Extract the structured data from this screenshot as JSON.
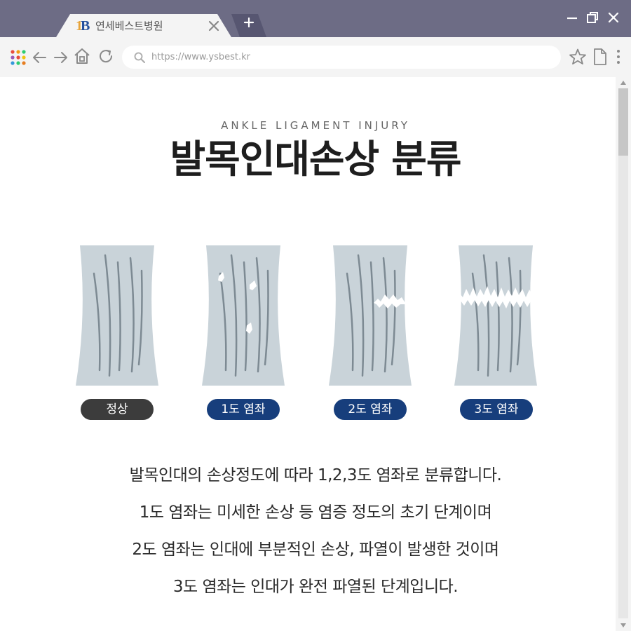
{
  "browser": {
    "tab_title": "연세베스트병원",
    "tab_logo": {
      "one": "1",
      "b": "B"
    },
    "url": "https://www.ysbest.kr",
    "icons": [
      "apps-grid-icon",
      "back-arrow-icon",
      "forward-arrow-icon",
      "home-icon",
      "reload-icon",
      "search-icon",
      "star-icon",
      "page-icon",
      "more-vert-icon",
      "minimize-icon",
      "restore-icon",
      "close-icon",
      "new-tab-icon"
    ]
  },
  "page": {
    "subtitle": "ANKLE LIGAMENT INJURY",
    "title": "발목인대손상 분류"
  },
  "grades": [
    {
      "label": "정상",
      "color": "#3c3c3c"
    },
    {
      "label": "1도 염좌",
      "color": "#173e7c"
    },
    {
      "label": "2도 염좌",
      "color": "#173e7c"
    },
    {
      "label": "3도 염좌",
      "color": "#173e7c"
    }
  ],
  "description": [
    "발목인대의 손상정도에 따라 1,2,3도 염좌로 분류합니다.",
    "1도 염좌는 미세한 손상 등 염증 정도의 초기 단계이며",
    "2도 염좌는 인대에 부분적인 손상, 파열이 발생한 것이며",
    "3도 염좌는 인대가 완전 파열된 단계입니다."
  ],
  "colors": {
    "titlebar": "#6d6c85",
    "ligament": "#c9d3d9",
    "fiber": "#7d8a93",
    "badge_normal": "#3c3c3c",
    "badge_sprain": "#173e7c"
  }
}
